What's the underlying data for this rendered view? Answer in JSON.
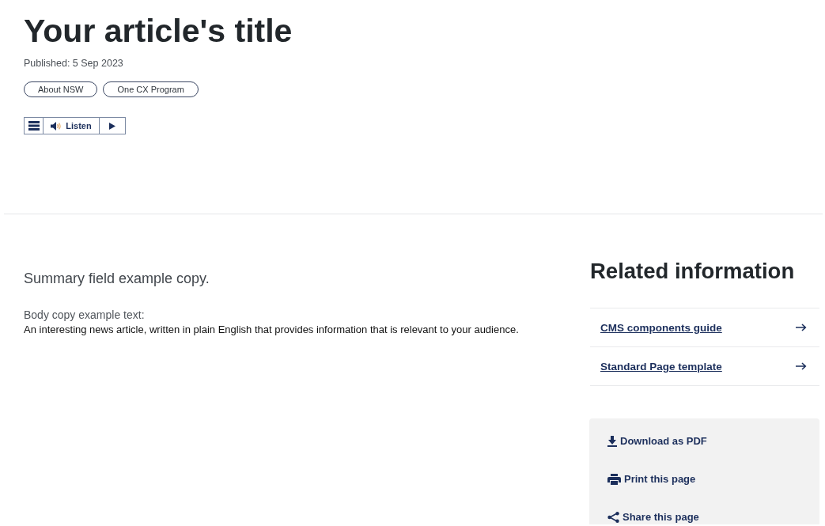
{
  "article": {
    "title": "Your article's title",
    "published": "Published: 5 Sep 2023",
    "tags": [
      {
        "label": "About NSW"
      },
      {
        "label": "One CX Program"
      }
    ]
  },
  "listen_toolbar": {
    "label": "Listen"
  },
  "content": {
    "summary": "Summary field example copy.",
    "body_label": "Body copy example text:",
    "body_text": "An interesting news article, written in plain English that provides information that is relevant to your audience."
  },
  "related": {
    "heading": "Related information",
    "links": [
      {
        "label": "CMS components guide"
      },
      {
        "label": "Standard Page template"
      }
    ]
  },
  "actions": [
    {
      "kind": "download",
      "label": "Download as PDF"
    },
    {
      "kind": "print",
      "label": "Print this page"
    },
    {
      "kind": "share",
      "label": "Share this page"
    }
  ]
}
